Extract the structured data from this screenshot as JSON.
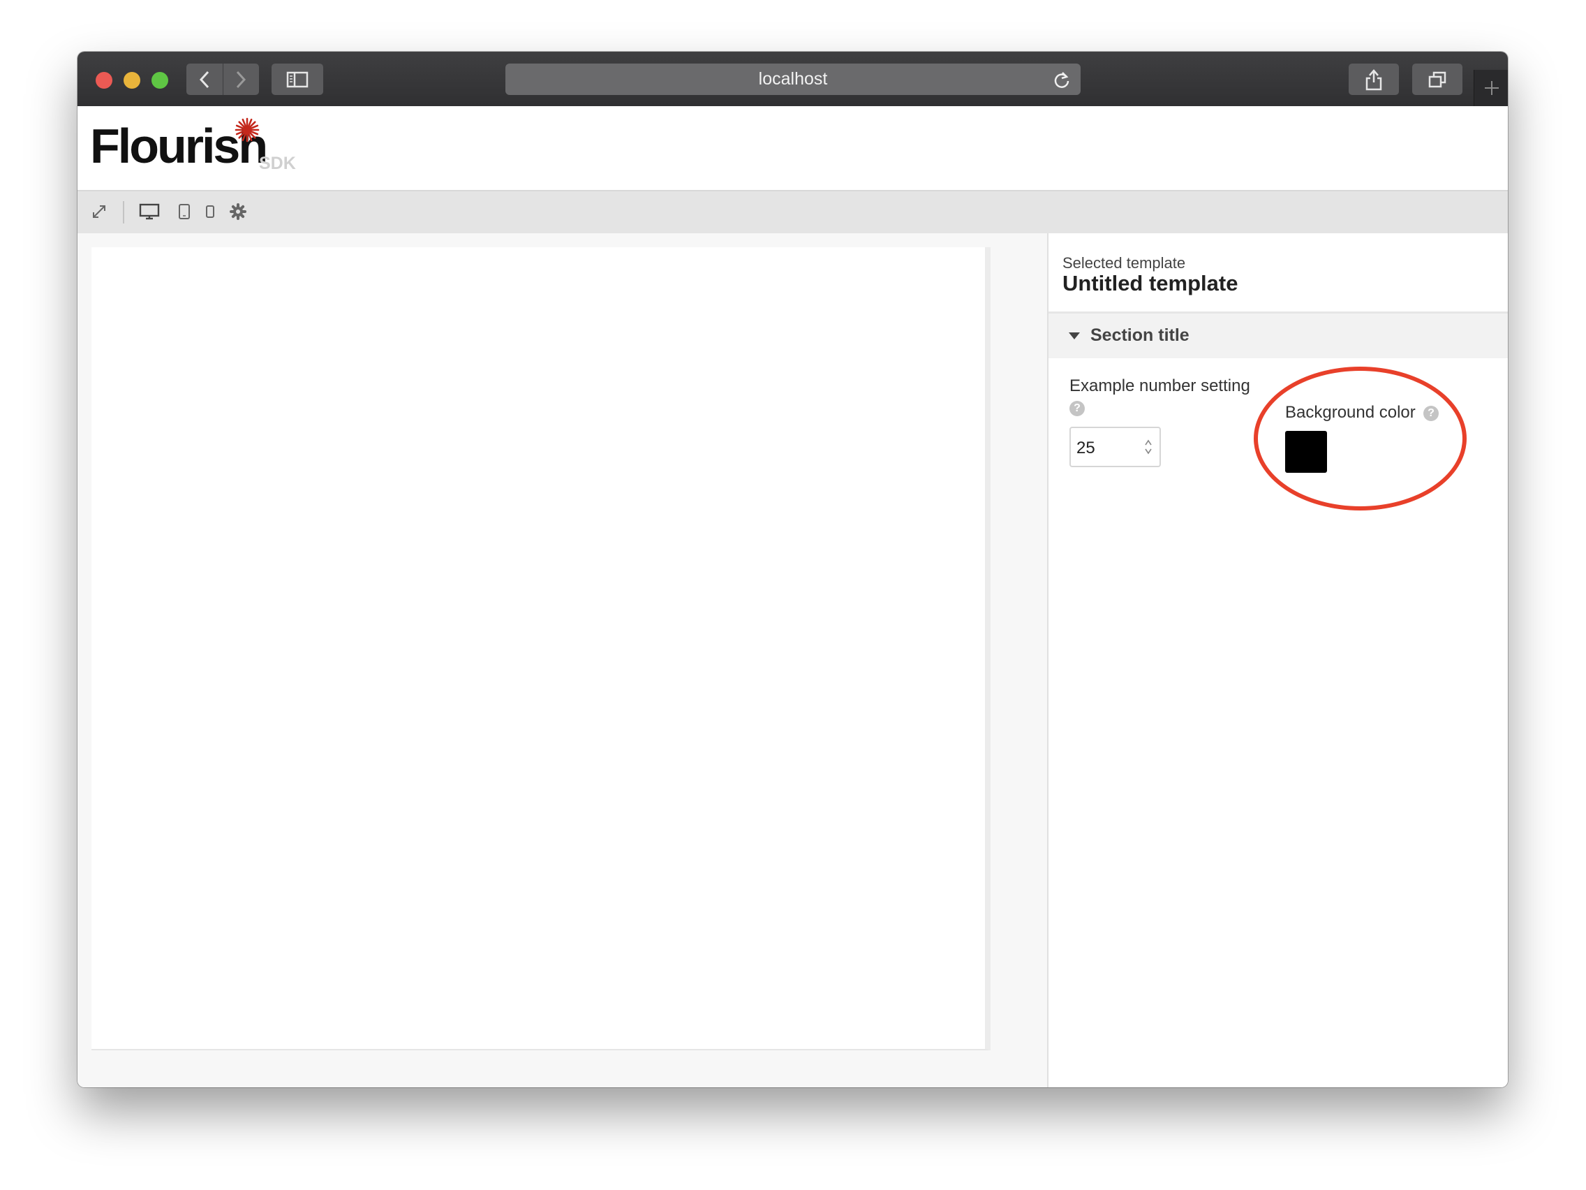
{
  "browser": {
    "address": "localhost",
    "icons": {
      "back": "chevron-left-icon",
      "forward": "chevron-right-icon",
      "sidebar": "sidebar-icon",
      "reload": "reload-icon",
      "share": "share-icon",
      "tabs": "tabs-icon",
      "new_tab": "plus-icon"
    }
  },
  "app": {
    "logo": "Flourish",
    "logo_sub": "SDK",
    "accent_color": "#c4281c"
  },
  "toolbar": {
    "icons": [
      "expand-icon",
      "desktop-icon",
      "tablet-icon",
      "phone-icon",
      "gear-icon"
    ]
  },
  "panel": {
    "selected_caption": "Selected template",
    "selected_title": "Untitled template",
    "section_title": "Section title",
    "number_setting": {
      "label": "Example number setting",
      "value": "25",
      "help": "?"
    },
    "background_color": {
      "label": "Background color",
      "value": "#000000",
      "help": "?"
    }
  },
  "annotation": {
    "highlight_color": "#e8402a"
  }
}
